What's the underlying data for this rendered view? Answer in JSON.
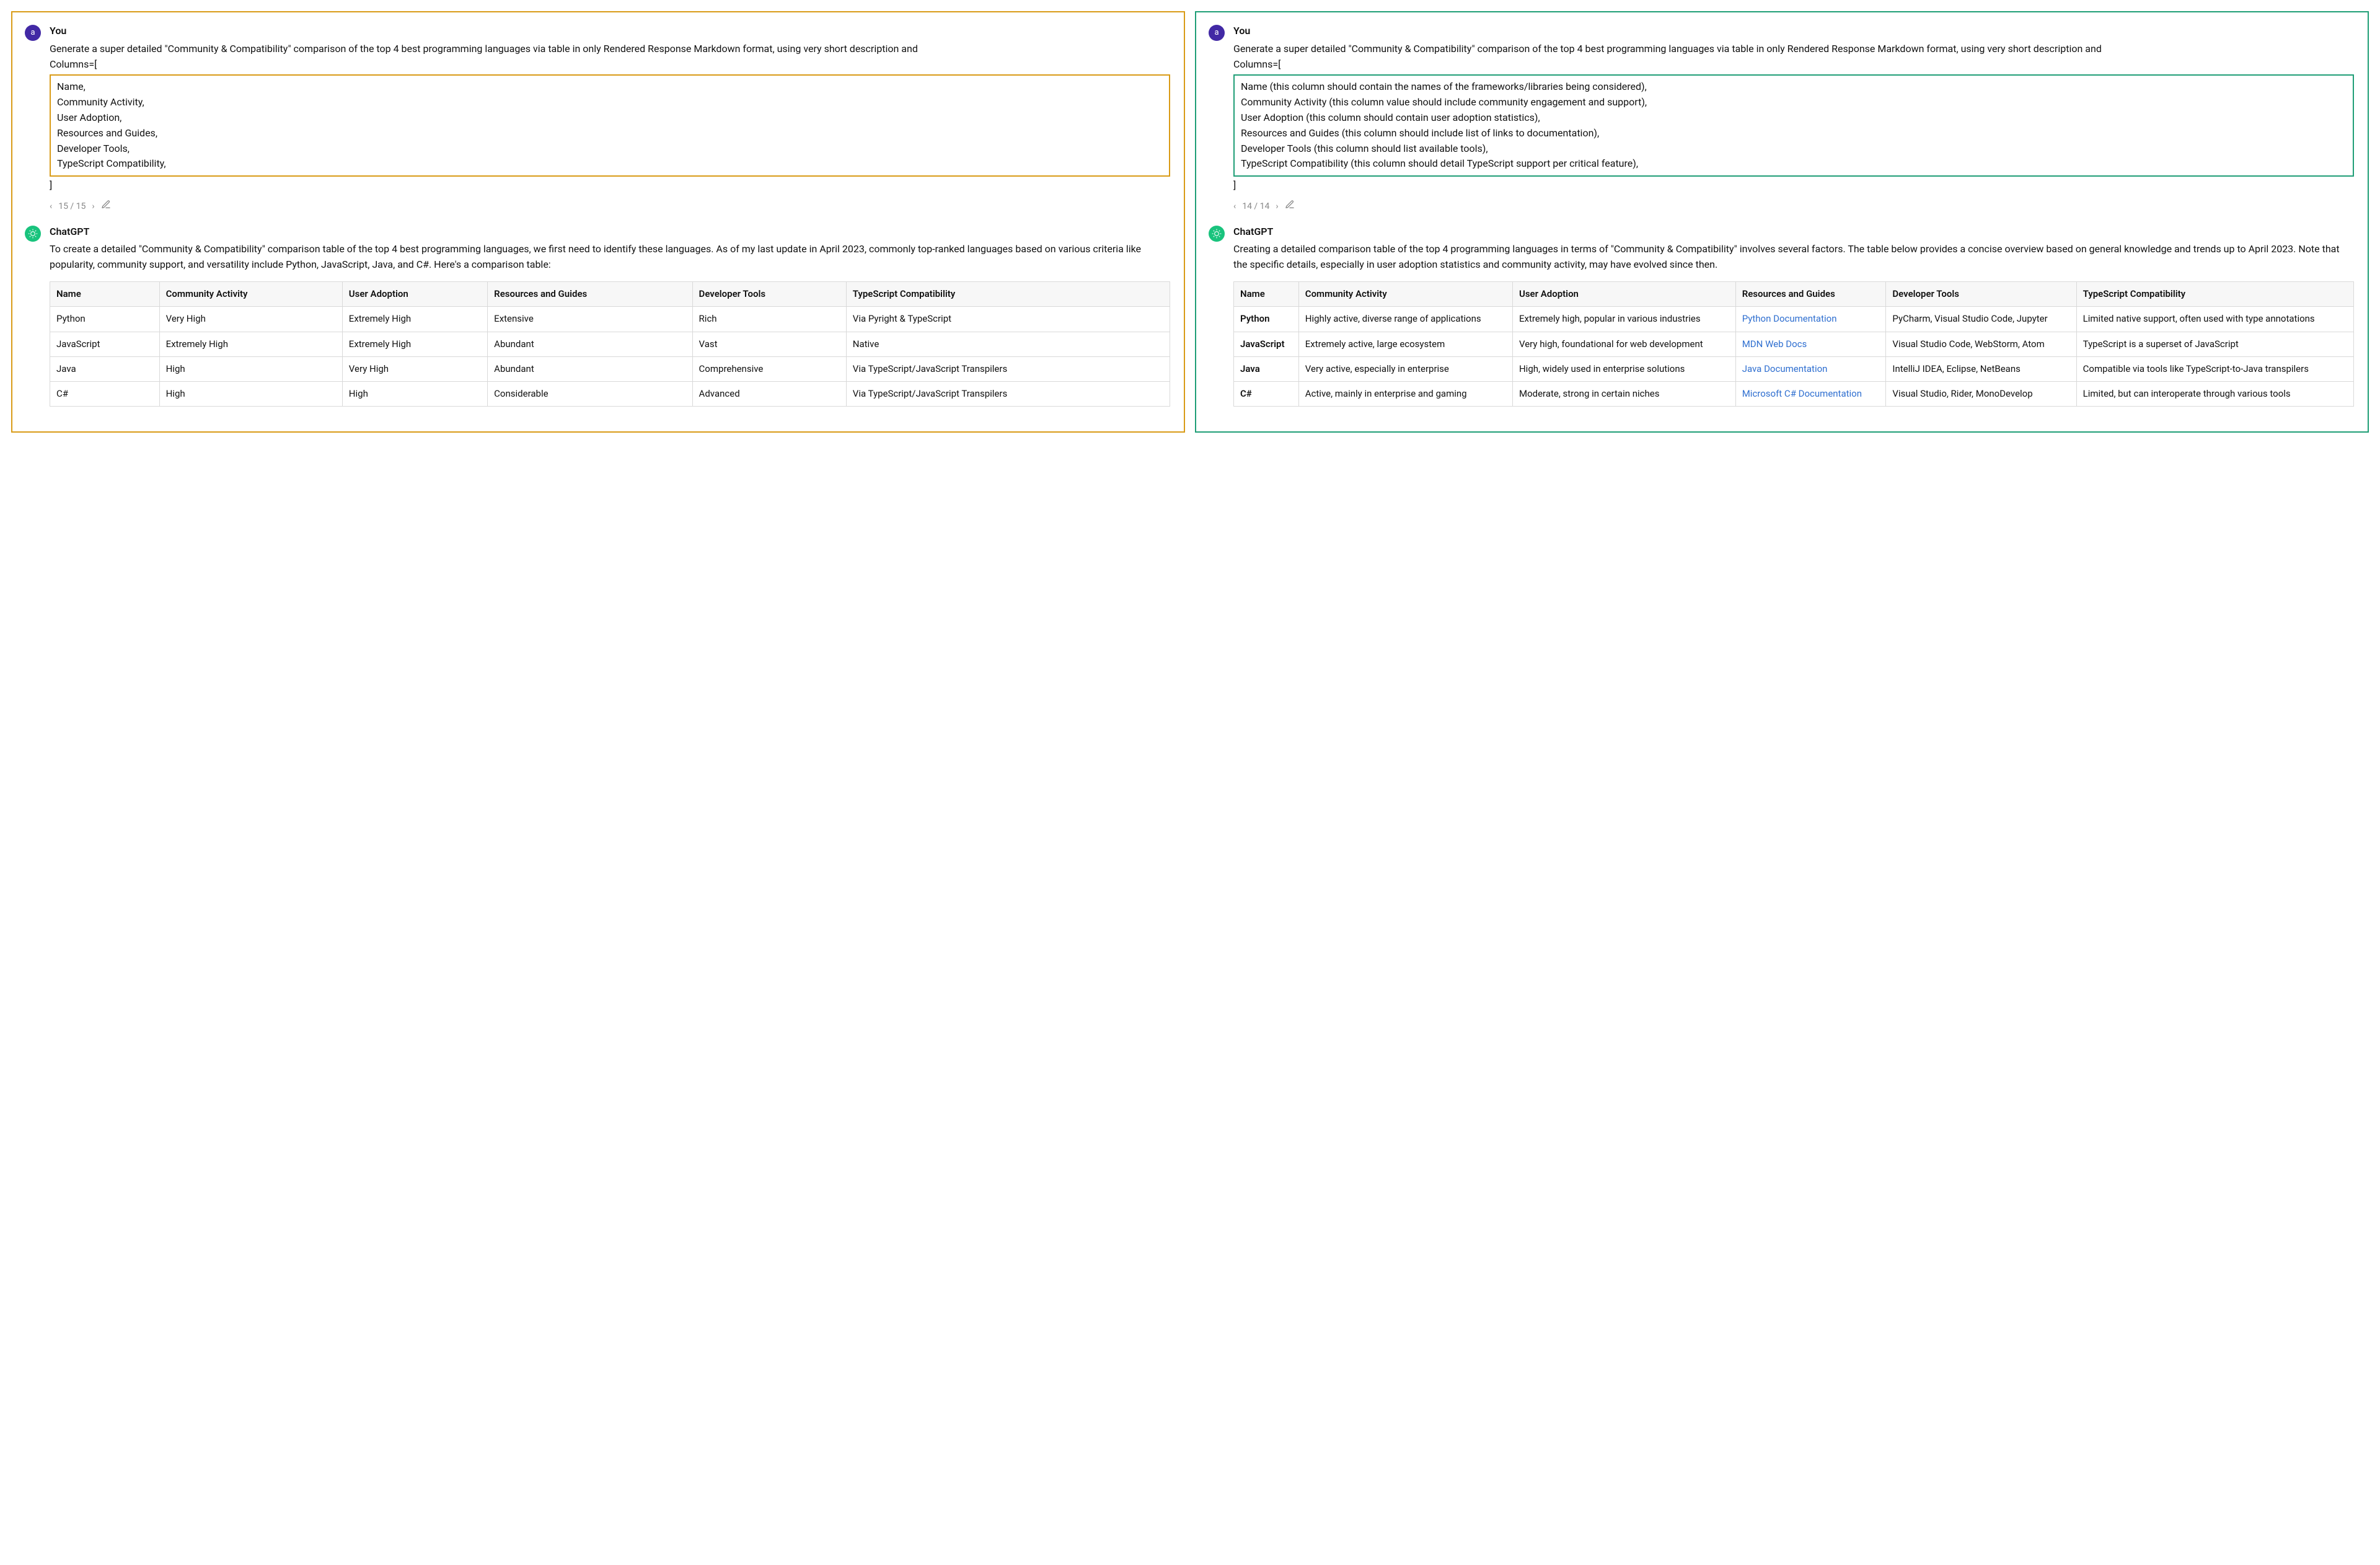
{
  "left": {
    "user_label": "You",
    "user_avatar_letter": "a",
    "assistant_label": "ChatGPT",
    "prompt_intro": "Generate a super detailed \"Community & Compatibility\" comparison of the top 4 best programming languages via table in only Rendered Response Markdown format, using very short description and",
    "columns_word": "Columns=[",
    "columns": [
      "Name,",
      "Community Activity,",
      "User Adoption,",
      "Resources and Guides,",
      "Developer Tools,",
      "TypeScript Compatibility,"
    ],
    "columns_close": "]",
    "pager_text": "15 / 15",
    "assistant_text": "To create a detailed \"Community & Compatibility\" comparison table of the top 4 best programming languages, we first need to identify these languages. As of my last update in April 2023, commonly top-ranked languages based on various criteria like popularity, community support, and versatility include Python, JavaScript, Java, and C#. Here's a comparison table:",
    "table_headers": [
      "Name",
      "Community Activity",
      "User Adoption",
      "Resources and Guides",
      "Developer Tools",
      "TypeScript Compatibility"
    ],
    "table_rows": [
      [
        "Python",
        "Very High",
        "Extremely High",
        "Extensive",
        "Rich",
        "Via Pyright & TypeScript"
      ],
      [
        "JavaScript",
        "Extremely High",
        "Extremely High",
        "Abundant",
        "Vast",
        "Native"
      ],
      [
        "Java",
        "High",
        "Very High",
        "Abundant",
        "Comprehensive",
        "Via TypeScript/JavaScript Transpilers"
      ],
      [
        "C#",
        "High",
        "High",
        "Considerable",
        "Advanced",
        "Via TypeScript/JavaScript Transpilers"
      ]
    ]
  },
  "right": {
    "user_label": "You",
    "user_avatar_letter": "a",
    "assistant_label": "ChatGPT",
    "prompt_intro": "Generate a super detailed \"Community & Compatibility\" comparison of the top 4 best programming languages via table in only Rendered Response Markdown format, using very short description and",
    "columns_word": "Columns=[",
    "columns": [
      "Name (this column should contain the names of the frameworks/libraries being considered),",
      "Community Activity (this column value should include community engagement and support),",
      "User Adoption (this column should contain user adoption statistics),",
      "Resources and Guides (this column should include list of links to documentation),",
      "Developer Tools (this column should list available tools),",
      "TypeScript Compatibility (this column should detail TypeScript support per critical feature),"
    ],
    "columns_close": "]",
    "pager_text": "14 / 14",
    "assistant_text": "Creating a detailed comparison table of the top 4 programming languages in terms of \"Community & Compatibility\" involves several factors. The table below provides a concise overview based on general knowledge and trends up to April 2023. Note that the specific details, especially in user adoption statistics and community activity, may have evolved since then.",
    "table_headers": [
      "Name",
      "Community Activity",
      "User Adoption",
      "Resources and Guides",
      "Developer Tools",
      "TypeScript Compatibility"
    ],
    "table_rows": [
      {
        "name": "Python",
        "activity": "Highly active, diverse range of applications",
        "adoption": "Extremely high, popular in various industries",
        "resources": "Python Documentation",
        "tools": "PyCharm, Visual Studio Code, Jupyter",
        "ts": "Limited native support, often used with type annotations"
      },
      {
        "name": "JavaScript",
        "activity": "Extremely active, large ecosystem",
        "adoption": "Very high, foundational for web development",
        "resources": "MDN Web Docs",
        "tools": "Visual Studio Code, WebStorm, Atom",
        "ts": "TypeScript is a superset of JavaScript"
      },
      {
        "name": "Java",
        "activity": "Very active, especially in enterprise",
        "adoption": "High, widely used in enterprise solutions",
        "resources": "Java Documentation",
        "tools": "IntelliJ IDEA, Eclipse, NetBeans",
        "ts": "Compatible via tools like TypeScript-to-Java transpilers"
      },
      {
        "name": "C#",
        "activity": "Active, mainly in enterprise and gaming",
        "adoption": "Moderate, strong in certain niches",
        "resources": "Microsoft C# Documentation",
        "tools": "Visual Studio, Rider, MonoDevelop",
        "ts": "Limited, but can interoperate through various tools"
      }
    ]
  }
}
